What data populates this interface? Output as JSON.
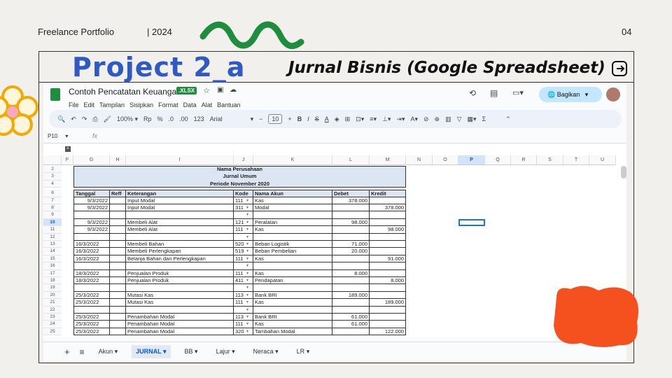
{
  "slide": {
    "left_label": "Freelance Portfolio",
    "year": "| 2024",
    "page": "04",
    "project": "Project 2_a",
    "subtitle": "Jurnal Bisnis (Google Spreadsheet)"
  },
  "app": {
    "doc_title": "Contoh Pencatatan Keuangan",
    "badge": ".XLSX",
    "menus": [
      "File",
      "Edit",
      "Tampilan",
      "Sisipkan",
      "Format",
      "Data",
      "Alat",
      "Bantuan"
    ],
    "share": "Bagikan",
    "zoom": "100%",
    "currency": "Rp",
    "percent": "%",
    "dec_less": ".0",
    "dec_more": ".00",
    "num_fmt": "123",
    "font": "Arial",
    "font_size": "10",
    "cell_ref": "P10",
    "fx": "fx"
  },
  "columns": [
    "F",
    "G",
    "H",
    "I",
    "J",
    "K",
    "L",
    "M",
    "N",
    "O",
    "P",
    "Q",
    "R",
    "S",
    "T",
    "U"
  ],
  "header_block": [
    "Nama Perusahaan",
    "Jurnal Umum",
    "Periode November 2020"
  ],
  "table_headers": [
    "Tanggal",
    "Reff",
    "Keterangan",
    "Kode",
    "Nama Akun",
    "Debet",
    "Kredit"
  ],
  "rows": [
    {
      "n": "7",
      "d": "9/3/2022",
      "k": "Input Modal",
      "c": "111",
      "a": "Kas",
      "db": "378.000",
      "kr": ""
    },
    {
      "n": "8",
      "d": "9/3/2022",
      "k": "Input Modal",
      "c": "311",
      "a": "Modal",
      "db": "",
      "kr": "378.000"
    },
    {
      "n": "9",
      "d": "",
      "k": "",
      "c": "",
      "a": "",
      "db": "",
      "kr": ""
    },
    {
      "n": "10",
      "d": "9/3/2022",
      "k": "Membeli Alat",
      "c": "121",
      "a": "Peralatan",
      "db": "98.000",
      "kr": ""
    },
    {
      "n": "11",
      "d": "9/3/2022",
      "k": "Membeli Alat",
      "c": "111",
      "a": "Kas",
      "db": "",
      "kr": "98.000"
    },
    {
      "n": "12",
      "d": "",
      "k": "",
      "c": "",
      "a": "",
      "db": "",
      "kr": ""
    },
    {
      "n": "13",
      "d": "16/3/2022",
      "k": "Membeli Bahan",
      "c": "520",
      "a": "Beban Logistik",
      "db": "71.000",
      "kr": ""
    },
    {
      "n": "14",
      "d": "16/3/2022",
      "k": "Membeli Perlengkapan",
      "c": "519",
      "a": "Beban Pembelian",
      "db": "20.000",
      "kr": ""
    },
    {
      "n": "15",
      "d": "16/3/2022",
      "k": "Belanja Bahan dan Perlengkapan",
      "c": "111",
      "a": "Kas",
      "db": "",
      "kr": "91.000"
    },
    {
      "n": "16",
      "d": "",
      "k": "",
      "c": "",
      "a": "",
      "db": "",
      "kr": ""
    },
    {
      "n": "17",
      "d": "18/3/2022",
      "k": "Penjualan Produk",
      "c": "111",
      "a": "Kas",
      "db": "8.000",
      "kr": ""
    },
    {
      "n": "18",
      "d": "18/3/2022",
      "k": "Penjualan Produk",
      "c": "411",
      "a": "Pendapatan",
      "db": "",
      "kr": "8.000"
    },
    {
      "n": "19",
      "d": "",
      "k": "",
      "c": "",
      "a": "",
      "db": "",
      "kr": ""
    },
    {
      "n": "20",
      "d": "25/3/2022",
      "k": "Mutasi Kas",
      "c": "113",
      "a": "Bank BRI",
      "db": "189.000",
      "kr": ""
    },
    {
      "n": "21",
      "d": "25/3/2022",
      "k": "Mutasi Kas",
      "c": "111",
      "a": "Kas",
      "db": "",
      "kr": "189.000"
    },
    {
      "n": "22",
      "d": "",
      "k": "",
      "c": "",
      "a": "",
      "db": "",
      "kr": ""
    },
    {
      "n": "23",
      "d": "25/3/2022",
      "k": "Penambahan Modal",
      "c": "113",
      "a": "Bank BRI",
      "db": "61.000",
      "kr": ""
    },
    {
      "n": "24",
      "d": "25/3/2022",
      "k": "Penambahan Modal",
      "c": "111",
      "a": "Kas",
      "db": "61.000",
      "kr": ""
    },
    {
      "n": "25",
      "d": "25/3/2022",
      "k": "Penambahan Modal",
      "c": "320",
      "a": "Tambahan Modal",
      "db": "",
      "kr": "122.000"
    }
  ],
  "header_row_numbers": [
    "2",
    "3",
    "4",
    "6"
  ],
  "tabs": [
    {
      "label": "Akun"
    },
    {
      "label": "JURNAL",
      "active": true
    },
    {
      "label": "BB"
    },
    {
      "label": "Lajur"
    },
    {
      "label": "Neraca"
    },
    {
      "label": "LR"
    }
  ],
  "colors": {
    "accent": "#2f5ac4",
    "green": "#1e8e3e",
    "orange": "#f4511e",
    "header_fill": "#dce6f2"
  }
}
